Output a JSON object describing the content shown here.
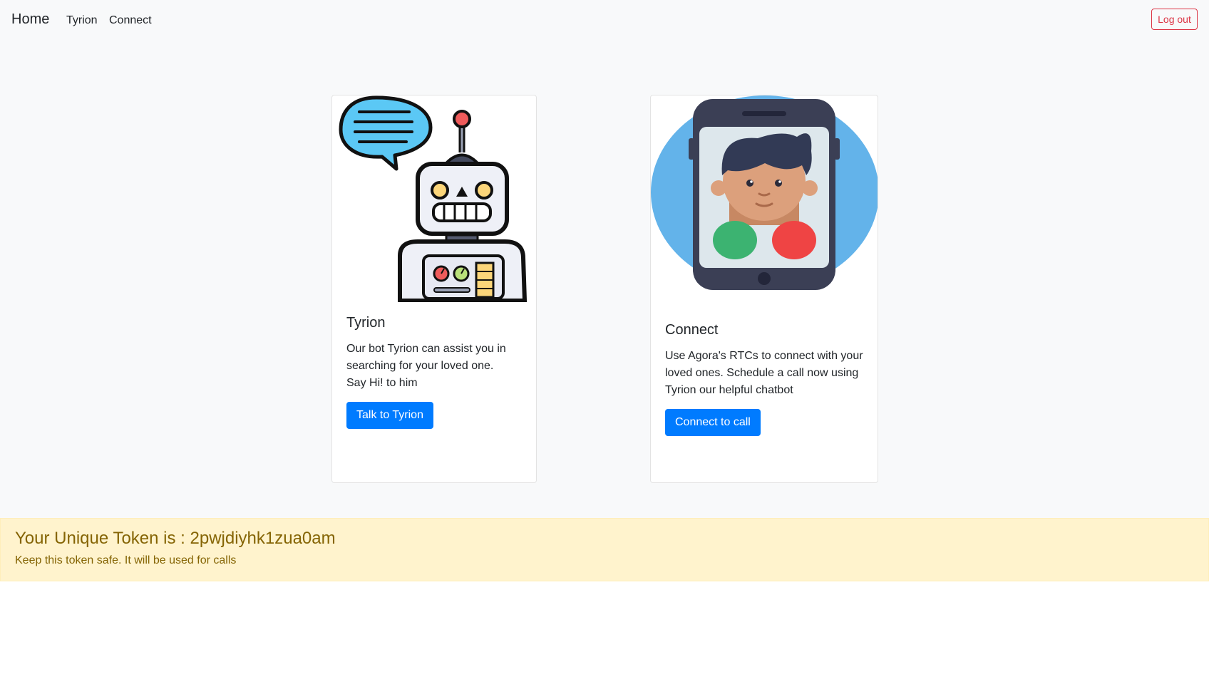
{
  "navbar": {
    "brand": "Home",
    "links": [
      "Tyrion",
      "Connect"
    ],
    "logout_label": "Log out"
  },
  "cards": [
    {
      "title": "Tyrion",
      "text_lines": [
        "Our bot Tyrion can assist you in",
        "searching for your loved one.",
        "Say Hi! to him"
      ],
      "button_label": "Talk to Tyrion",
      "image": "robot-with-speech-bubble"
    },
    {
      "title": "Connect",
      "text_lines": [
        "Use Agora's RTCs to connect with your",
        "loved ones. Schedule a call now using",
        "Tyrion our helpful chatbot"
      ],
      "button_label": "Connect to call",
      "image": "phone-video-call"
    }
  ],
  "token_alert": {
    "heading": "Your Unique Token is : 2pwjdiyhk1zua0am",
    "text": "Keep this token safe. It will be used for calls"
  },
  "colors": {
    "primary": "#007bff",
    "danger": "#dc3545",
    "warning_bg": "#fff3cd",
    "warning_text": "#856404",
    "page_bg": "#f8f9fa"
  }
}
